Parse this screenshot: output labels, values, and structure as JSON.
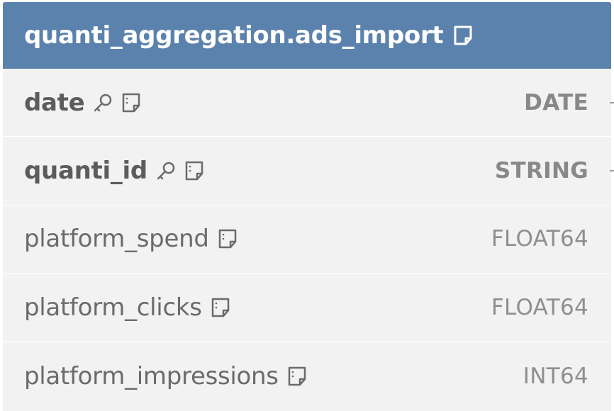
{
  "table": {
    "title": "quanti_aggregation.ads_import",
    "header_color": "#5b82ad",
    "icons": [
      "note-icon"
    ],
    "fields": [
      {
        "name": "date",
        "type": "DATE",
        "primary_key": true,
        "icons": [
          "key-icon",
          "note-icon"
        ]
      },
      {
        "name": "quanti_id",
        "type": "STRING",
        "primary_key": true,
        "icons": [
          "key-icon",
          "note-icon"
        ]
      },
      {
        "name": "platform_spend",
        "type": "FLOAT64",
        "primary_key": false,
        "icons": [
          "note-icon"
        ]
      },
      {
        "name": "platform_clicks",
        "type": "FLOAT64",
        "primary_key": false,
        "icons": [
          "note-icon"
        ]
      },
      {
        "name": "platform_impressions",
        "type": "INT64",
        "primary_key": false,
        "icons": [
          "note-icon"
        ]
      }
    ]
  }
}
